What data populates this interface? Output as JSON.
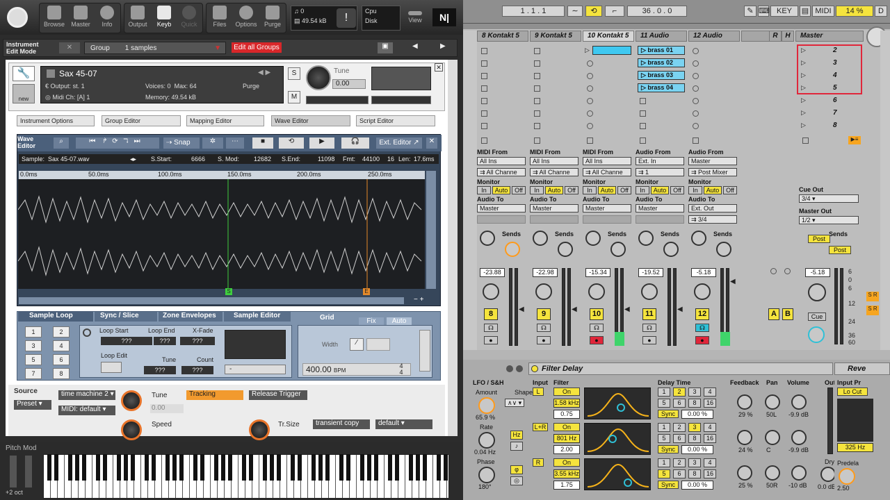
{
  "kontakt": {
    "toolbar": [
      "Browse",
      "Master",
      "Info",
      "Output",
      "Keyb",
      "Quick",
      "Files",
      "Options",
      "Purge",
      "View"
    ],
    "voices_meter": "0",
    "memory_meter": "49.54 kB",
    "cpu_label": "Cpu",
    "disk_label": "Disk",
    "mode_label": "Instrument Edit Mode",
    "group_label": "Group",
    "samples_count": "1 samples",
    "edit_all_groups": "Edit all Groups",
    "instrument": {
      "name": "Sax 45-07",
      "output": "st. 1",
      "midi_ch": "[A] 1",
      "voices": "0",
      "max": "64",
      "memory": "49.54 kB",
      "purge": "Purge",
      "tune_label": "Tune",
      "tune_value": "0.00",
      "new_label": "new",
      "s_label": "S",
      "m_label": "M",
      "output_label": "Output:",
      "voices_label": "Voices:",
      "max_label": "Max:",
      "midi_label": "Midi Ch:",
      "memory_label": "Memory:"
    },
    "tabs": [
      "Instrument Options",
      "Group Editor",
      "Mapping Editor",
      "Wave Editor",
      "Script Editor"
    ],
    "wave": {
      "title": "Wave Editor",
      "snap": "Snap",
      "ext_editor": "Ext. Editor",
      "sample_label": "Sample:",
      "sample": "Sax 45-07.wav",
      "s_start_label": "S.Start:",
      "s_start": "6666",
      "s_mod_label": "S. Mod:",
      "s_mod": "12682",
      "s_end_label": "S.End:",
      "s_end": "11098",
      "fmt_label": "Fmt:",
      "fmt": "44100",
      "bits": "16",
      "len_label": "Len:",
      "len": "17.6ms",
      "ticks": [
        "0.0ms",
        "50.0ms",
        "100.0ms",
        "150.0ms",
        "200.0ms",
        "250.0ms"
      ],
      "marker_s": "S",
      "marker_e": "E"
    },
    "subtabs": [
      "Sample Loop",
      "Sync / Slice",
      "Zone Envelopes",
      "Sample Editor"
    ],
    "loop": {
      "numbers": [
        "1",
        "2",
        "3",
        "4",
        "5",
        "6",
        "7",
        "8"
      ],
      "loop_start": "Loop Start",
      "loop_end": "Loop End",
      "xfade": "X-Fade",
      "loop_edit": "Loop Edit",
      "tune": "Tune",
      "count": "Count",
      "qqq": "???",
      "dash": "-"
    },
    "grid": {
      "label": "Grid",
      "fix": "Fix",
      "auto": "Auto",
      "width": "Width",
      "bpm_value": "400.00",
      "bpm_unit": "BPM",
      "time_sig_top": "4",
      "time_sig_bottom": "4"
    },
    "source": {
      "label": "Source",
      "preset": "Preset",
      "time_machine": "time machine 2",
      "midi": "MIDI: default",
      "tune": "Tune",
      "tune_value": "0.00",
      "speed": "Speed",
      "tracking": "Tracking",
      "release_trigger": "Release Trigger",
      "tr_size": "Tr.Size",
      "transient_copy": "transient copy",
      "default": "default"
    },
    "pitch_mod": "Pitch Mod",
    "octave": "+2 oct"
  },
  "live": {
    "transport": {
      "pos1": "1 .  1 .  1",
      "pos2": "36 .  0 .  0",
      "key": "KEY",
      "midi": "MIDI",
      "cpu": "14 %",
      "d": "D"
    },
    "tracks": [
      {
        "name": "8 Kontakt 5",
        "num": "8",
        "vol": "-23.88",
        "in_type": "MIDI From",
        "in": "All Ins",
        "ch": "All Channe",
        "to": "Master"
      },
      {
        "name": "9 Kontakt 5",
        "num": "9",
        "vol": "-22.98",
        "in_type": "MIDI From",
        "in": "All Ins",
        "ch": "All Channe",
        "to": "Master"
      },
      {
        "name": "10 Kontakt 5",
        "num": "10",
        "vol": "-15.34",
        "in_type": "MIDI From",
        "in": "All Ins",
        "ch": "All Channe",
        "to": "Master"
      },
      {
        "name": "11 Audio",
        "num": "11",
        "vol": "-19.52",
        "in_type": "Audio From",
        "in": "Ext. In",
        "ch": "1",
        "to": "Master"
      },
      {
        "name": "12 Audio",
        "num": "12",
        "vol": "-5.18",
        "in_type": "Audio From",
        "in": "Master",
        "ch": "Post Mixer",
        "to": "Ext. Out",
        "sub": "3/4"
      }
    ],
    "clips": [
      "brass 01",
      "brass 02",
      "brass 03",
      "brass 04"
    ],
    "returns": [
      "R",
      "H"
    ],
    "return_letters": [
      "A",
      "B"
    ],
    "master": {
      "name": "Master",
      "scenes": [
        "2",
        "3",
        "4",
        "5",
        "6",
        "7",
        "8"
      ],
      "cue_out": "Cue Out",
      "cue_val": "3/4",
      "master_out": "Master Out",
      "master_val": "1/2",
      "vol": "-5.18",
      "cue": "Cue",
      "sends": "Sends",
      "post": "Post",
      "scale": [
        "6",
        "0",
        "6",
        "12",
        "24",
        "36",
        "60"
      ]
    },
    "monitor": {
      "label": "Monitor",
      "in": "In",
      "auto": "Auto",
      "off": "Off",
      "audio_to": "Audio To",
      "sends": "Sends"
    },
    "filter_delay": {
      "title": "Filter Delay",
      "lfo": "LFO / S&H",
      "amount": "Amount",
      "shape": "Shape",
      "amount_val": "65.9 %",
      "rate": "Rate",
      "rate_val": "0.04 Hz",
      "hz": "Hz",
      "phase": "Phase",
      "phase_val": "180°",
      "input": "Input",
      "filter": "Filter",
      "l": "L",
      "lr": "L+R",
      "r": "R",
      "on": "On",
      "f1": "1.58",
      "f1u": "kHz",
      "q1": "0.75",
      "f2": "801",
      "f2u": "Hz",
      "q2": "2.00",
      "f3": "3.55",
      "f3u": "kHz",
      "q3": "1.75",
      "delay_time": "Delay Time",
      "grid_nums": [
        "1",
        "2",
        "3",
        "4",
        "5",
        "6",
        "8",
        "16"
      ],
      "sync": "Sync",
      "pct": "0.00 %",
      "feedback": "Feedback",
      "pan": "Pan",
      "volume": "Volume",
      "fb": [
        "29 %",
        "24 %",
        "25 %"
      ],
      "pans": [
        "50L",
        "C",
        "50R"
      ],
      "vols": [
        "-9.9 dB",
        "-9.9 dB",
        "-10 dB"
      ],
      "out": "Out",
      "dry": "Dry",
      "dry_val": "0.0 dB"
    },
    "reverb": {
      "title": "Reve",
      "input": "Input Pr",
      "lo_cut": "Lo Cut",
      "hz": "325 Hz",
      "predelay": "Predela",
      "pd_val": "2.50"
    }
  }
}
